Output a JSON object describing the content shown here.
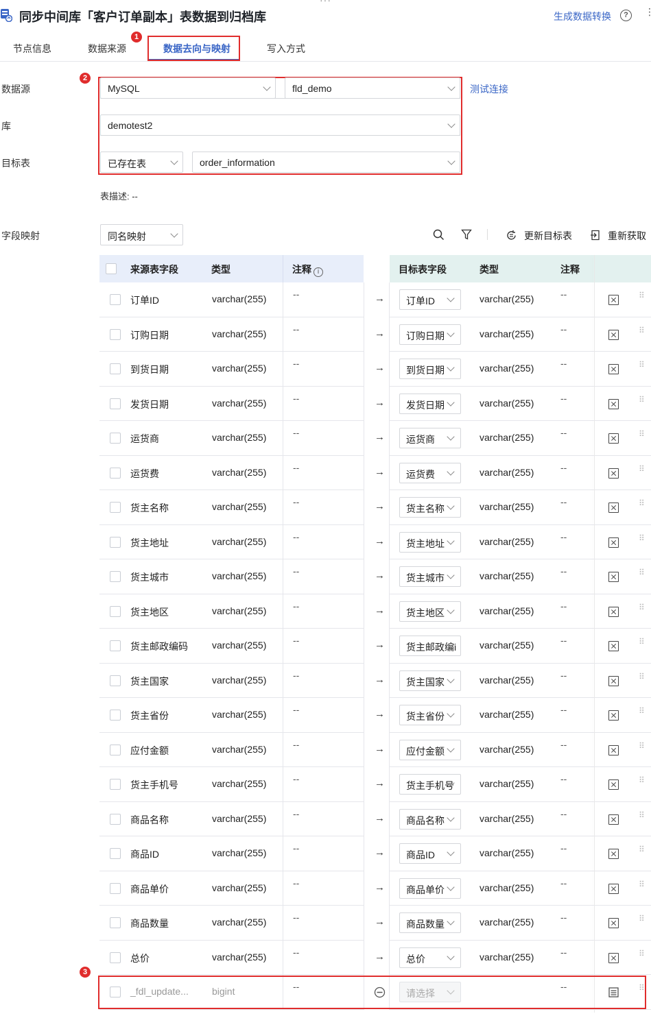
{
  "header": {
    "title": "同步中间库「客户订单副本」表数据到归档库",
    "generate_link": "生成数据转换",
    "help_icon": "?",
    "more": "⋮",
    "top_dots": "···"
  },
  "tabs": [
    {
      "label": "节点信息",
      "active": false
    },
    {
      "label": "数据来源",
      "active": false
    },
    {
      "label": "数据去向与映射",
      "active": true
    },
    {
      "label": "写入方式",
      "active": false
    }
  ],
  "badges": {
    "b1": "1",
    "b2": "2",
    "b3": "3"
  },
  "form": {
    "datasource_label": "数据源",
    "datasource_type": "MySQL",
    "datasource_conn": "fld_demo",
    "test_connection": "测试连接",
    "db_label": "库",
    "db_value": "demotest2",
    "target_label": "目标表",
    "target_mode": "已存在表",
    "target_table": "order_information",
    "table_desc": "表描述: --"
  },
  "mapping": {
    "label": "字段映射",
    "mode": "同名映射",
    "refresh_target": "更新目标表",
    "refetch": "重新获取"
  },
  "table": {
    "src_headers": [
      "来源表字段",
      "类型",
      "注释"
    ],
    "tgt_headers": [
      "目标表字段",
      "类型",
      "注释"
    ],
    "rows": [
      {
        "src": "订单ID",
        "type": "varchar(255)",
        "note": "--",
        "tgt": "订单ID",
        "ttype": "varchar(255)",
        "tnote": "--"
      },
      {
        "src": "订购日期",
        "type": "varchar(255)",
        "note": "--",
        "tgt": "订购日期",
        "ttype": "varchar(255)",
        "tnote": "--"
      },
      {
        "src": "到货日期",
        "type": "varchar(255)",
        "note": "--",
        "tgt": "到货日期",
        "ttype": "varchar(255)",
        "tnote": "--"
      },
      {
        "src": "发货日期",
        "type": "varchar(255)",
        "note": "--",
        "tgt": "发货日期",
        "ttype": "varchar(255)",
        "tnote": "--"
      },
      {
        "src": "运货商",
        "type": "varchar(255)",
        "note": "--",
        "tgt": "运货商",
        "ttype": "varchar(255)",
        "tnote": "--"
      },
      {
        "src": "运货费",
        "type": "varchar(255)",
        "note": "--",
        "tgt": "运货费",
        "ttype": "varchar(255)",
        "tnote": "--"
      },
      {
        "src": "货主名称",
        "type": "varchar(255)",
        "note": "--",
        "tgt": "货主名称",
        "ttype": "varchar(255)",
        "tnote": "--"
      },
      {
        "src": "货主地址",
        "type": "varchar(255)",
        "note": "--",
        "tgt": "货主地址",
        "ttype": "varchar(255)",
        "tnote": "--"
      },
      {
        "src": "货主城市",
        "type": "varchar(255)",
        "note": "--",
        "tgt": "货主城市",
        "ttype": "varchar(255)",
        "tnote": "--"
      },
      {
        "src": "货主地区",
        "type": "varchar(255)",
        "note": "--",
        "tgt": "货主地区",
        "ttype": "varchar(255)",
        "tnote": "--"
      },
      {
        "src": "货主邮政编码",
        "type": "varchar(255)",
        "note": "--",
        "tgt": "货主邮政编i",
        "ttype": "varchar(255)",
        "tnote": "--"
      },
      {
        "src": "货主国家",
        "type": "varchar(255)",
        "note": "--",
        "tgt": "货主国家",
        "ttype": "varchar(255)",
        "tnote": "--"
      },
      {
        "src": "货主省份",
        "type": "varchar(255)",
        "note": "--",
        "tgt": "货主省份",
        "ttype": "varchar(255)",
        "tnote": "--"
      },
      {
        "src": "应付金额",
        "type": "varchar(255)",
        "note": "--",
        "tgt": "应付金额",
        "ttype": "varchar(255)",
        "tnote": "--"
      },
      {
        "src": "货主手机号",
        "type": "varchar(255)",
        "note": "--",
        "tgt": "货主手机号",
        "ttype": "varchar(255)",
        "tnote": "--"
      },
      {
        "src": "商品名称",
        "type": "varchar(255)",
        "note": "--",
        "tgt": "商品名称",
        "ttype": "varchar(255)",
        "tnote": "--"
      },
      {
        "src": "商品ID",
        "type": "varchar(255)",
        "note": "--",
        "tgt": "商品ID",
        "ttype": "varchar(255)",
        "tnote": "--"
      },
      {
        "src": "商品单价",
        "type": "varchar(255)",
        "note": "--",
        "tgt": "商品单价",
        "ttype": "varchar(255)",
        "tnote": "--"
      },
      {
        "src": "商品数量",
        "type": "varchar(255)",
        "note": "--",
        "tgt": "商品数量",
        "ttype": "varchar(255)",
        "tnote": "--"
      },
      {
        "src": "总价",
        "type": "varchar(255)",
        "note": "--",
        "tgt": "总价",
        "ttype": "varchar(255)",
        "tnote": "--"
      }
    ],
    "extra_row": {
      "src": "_fdl_update...",
      "type": "bigint",
      "note": "--",
      "tgt": "请选择",
      "tnote": "--"
    }
  },
  "colors": {
    "accent": "#3a66c6",
    "highlight": "#e02c2c"
  }
}
